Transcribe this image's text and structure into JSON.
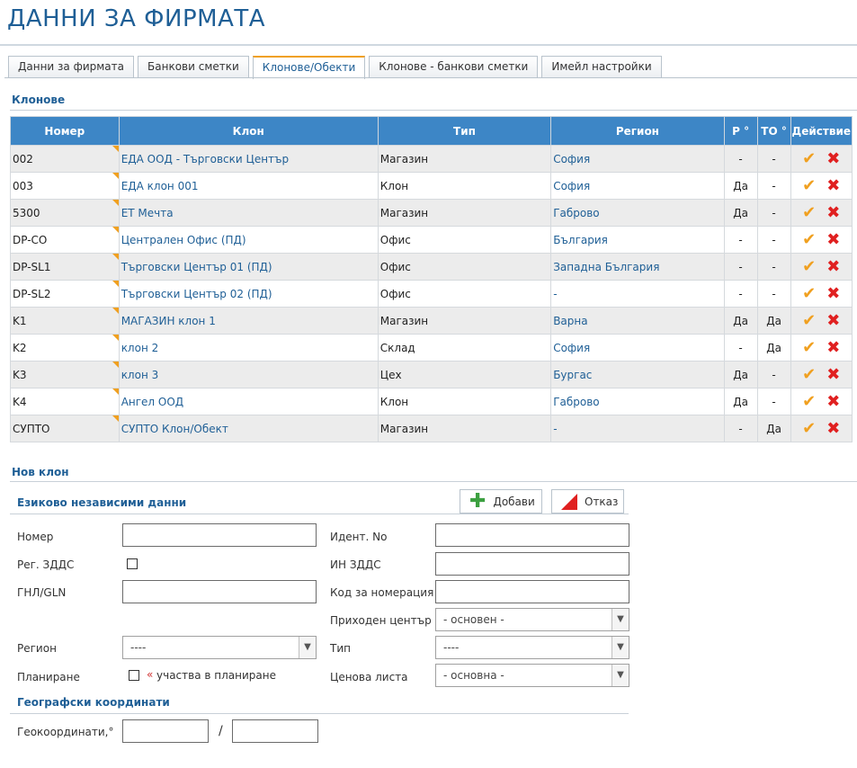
{
  "page": {
    "title": "ДАННИ ЗА ФИРМАТА"
  },
  "tabs": [
    {
      "label": "Данни за фирмата"
    },
    {
      "label": "Банкови сметки"
    },
    {
      "label": "Клонове/Обекти"
    },
    {
      "label": "Клонове - банкови сметки"
    },
    {
      "label": "Имейл настройки"
    }
  ],
  "branches": {
    "title": "Клонове",
    "columns": [
      "Номер",
      "Клон",
      "Тип",
      "Регион",
      "Р °",
      "ТО °",
      "Действие"
    ],
    "rows": [
      {
        "num": "002",
        "name": "ЕДА ООД - Търговски Център",
        "type": "Магазин",
        "region": "София",
        "r": "-",
        "to": "-"
      },
      {
        "num": "003",
        "name": "ЕДА клон 001",
        "type": "Клон",
        "region": "София",
        "r": "Да",
        "to": "-"
      },
      {
        "num": "5300",
        "name": "ЕТ Мечта",
        "type": "Магазин",
        "region": "Габрово",
        "r": "Да",
        "to": "-"
      },
      {
        "num": "DP-CO",
        "name": "Централен Офис (ПД)",
        "type": "Офис",
        "region": "България",
        "r": "-",
        "to": "-"
      },
      {
        "num": "DP-SL1",
        "name": "Търговски Център 01 (ПД)",
        "type": "Офис",
        "region": "Западна България",
        "r": "-",
        "to": "-"
      },
      {
        "num": "DP-SL2",
        "name": "Търговски Център 02 (ПД)",
        "type": "Офис",
        "region": "-",
        "r": "-",
        "to": "-"
      },
      {
        "num": "K1",
        "name": "МАГАЗИН клон 1",
        "type": "Магазин",
        "region": "Варна",
        "r": "Да",
        "to": "Да"
      },
      {
        "num": "K2",
        "name": "клон 2",
        "type": "Склад",
        "region": "София",
        "r": "-",
        "to": "Да"
      },
      {
        "num": "K3",
        "name": "клон 3",
        "type": "Цех",
        "region": "Бургас",
        "r": "Да",
        "to": "-"
      },
      {
        "num": "K4",
        "name": "Ангел ООД",
        "type": "Клон",
        "region": "Габрово",
        "r": "Да",
        "to": "-"
      },
      {
        "num": "СУПТО",
        "name": "СУПТО Клон/Обект",
        "type": "Магазин",
        "region": "-",
        "r": "-",
        "to": "Да"
      }
    ]
  },
  "new_branch": {
    "title": "Нов клон",
    "subtitle": "Езиково независими данни",
    "add_label": "Добави",
    "cancel_label": "Отказ",
    "labels": {
      "number": "Номер",
      "vat_reg": "Рег. ЗДДС",
      "gln": "ГНЛ/GLN",
      "region": "Регион",
      "planning": "Планиране",
      "ident_no": "Идент. No",
      "vat_id": "ИН ЗДДС",
      "numbering_code": "Код за номерация",
      "revenue_center": "Приходен център",
      "type": "Тип",
      "price_list": "Ценова листа"
    },
    "planning_text": "участва в планиране",
    "required_mark": "«",
    "selects": {
      "region": "----",
      "revenue_center": "- основен -",
      "type": "----",
      "price_list": "- основна -"
    },
    "geo_title": "Географски координати",
    "geo_label": "Геокоординати,°",
    "geo_separator": "/"
  }
}
